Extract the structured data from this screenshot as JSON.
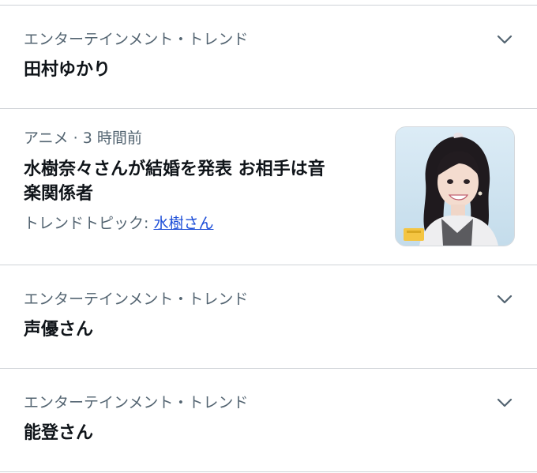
{
  "trends": [
    {
      "category": "エンターテインメント・トレンド",
      "title": "田村ゆかり"
    },
    {
      "category": "エンターテインメント・トレンド",
      "title": "声優さん"
    },
    {
      "category": "エンターテインメント・トレンド",
      "title": "能登さん"
    }
  ],
  "news": {
    "meta": "アニメ · 3 時間前",
    "title_line1": "水樹奈々さんが結婚を発表 お相手は音",
    "title_line2": "楽関係者",
    "topic_label": "トレンドトピック: ",
    "topic_link": "水樹さん"
  },
  "icons": {
    "chevron": "chevron-down-icon"
  },
  "colors": {
    "text_primary": "#0f1419",
    "text_secondary": "#536471",
    "link": "#1d4ed8",
    "divider": "#cfd3d7"
  }
}
